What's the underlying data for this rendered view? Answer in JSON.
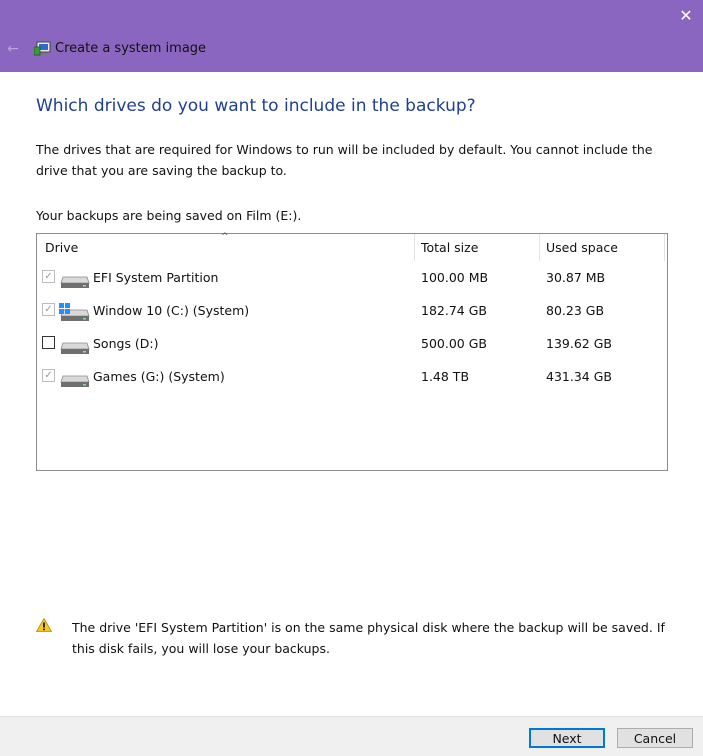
{
  "window": {
    "title": "Create a system image",
    "close_glyph": "✕",
    "back_glyph": "←"
  },
  "heading": "Which drives do you want to include in the backup?",
  "description": "The drives that are required for Windows to run will be included by default. You cannot include the drive that you are saving the backup to.",
  "saved_on": "Your backups are being saved on Film (E:).",
  "table": {
    "columns": {
      "drive": "Drive",
      "total": "Total size",
      "used": "Used space"
    },
    "rows": [
      {
        "name": "EFI System Partition",
        "total": "100.00 MB",
        "used": "30.87 MB",
        "checked": true,
        "enabled": false,
        "icon": "drive-icon"
      },
      {
        "name": "Window 10 (C:) (System)",
        "total": "182.74 GB",
        "used": "80.23 GB",
        "checked": true,
        "enabled": false,
        "icon": "windows-drive-icon"
      },
      {
        "name": "Songs (D:)",
        "total": "500.00 GB",
        "used": "139.62 GB",
        "checked": false,
        "enabled": true,
        "icon": "drive-icon"
      },
      {
        "name": "Games (G:) (System)",
        "total": "1.48 TB",
        "used": "431.34 GB",
        "checked": true,
        "enabled": false,
        "icon": "drive-icon"
      }
    ]
  },
  "warning": "The drive 'EFI System Partition' is on the same physical disk where the backup will be saved. If this disk fails, you will lose your backups.",
  "buttons": {
    "next": "Next",
    "cancel": "Cancel"
  },
  "colors": {
    "titlebar": "#8a66c0",
    "heading": "#1f3f94",
    "accent": "#0078d7"
  }
}
